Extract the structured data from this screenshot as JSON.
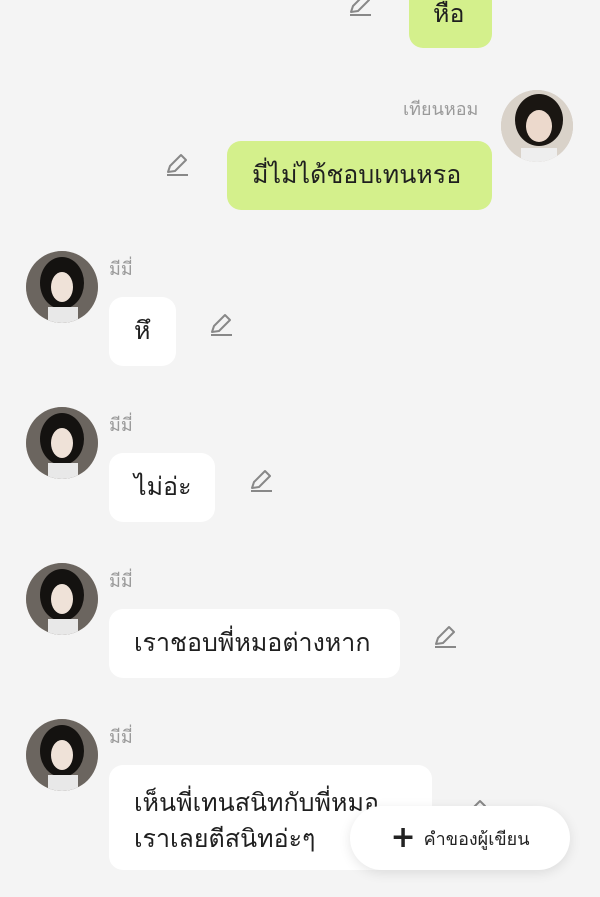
{
  "messages": [
    {
      "text": "หือ",
      "sender": "",
      "side": "right"
    },
    {
      "text": "มี่ไม่ได้ชอบเทนหรอ",
      "sender": "เทียนหอม",
      "side": "right"
    },
    {
      "text": "หึ",
      "sender": "มีมี่",
      "side": "left"
    },
    {
      "text": "ไม่อ่ะ",
      "sender": "มีมี่",
      "side": "left"
    },
    {
      "text": "เราชอบพี่หมอต่างหาก",
      "sender": "มีมี่",
      "side": "left"
    },
    {
      "text_line1": "เห็นพี่เทนสนิทกับพี่หมอ",
      "text_line2": "เราเลยตีสนิทอ่ะๆ",
      "sender": "มีมี่",
      "side": "left"
    }
  ],
  "fab": {
    "icon": "plus-icon",
    "label": "คำของผู้เขียน"
  },
  "colors": {
    "background": "#f4f4f4",
    "outgoing_bubble": "#d4f08c",
    "incoming_bubble": "#ffffff",
    "name": "#9a9a9a"
  }
}
